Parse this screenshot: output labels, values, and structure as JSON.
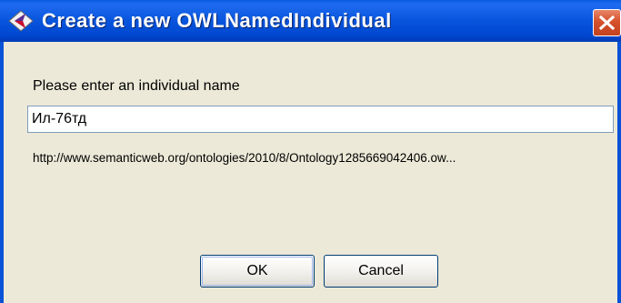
{
  "window": {
    "title": "Create a new OWLNamedIndividual",
    "icons": {
      "app": "protege-diamond-icon",
      "close": "close-icon"
    },
    "colors": {
      "titlebar": "#0855dd",
      "close_button": "#d6512c",
      "background": "#ece9d8"
    }
  },
  "form": {
    "prompt_label": "Please enter an individual name",
    "name_value": "Ил-76тд",
    "iri_preview": "http://www.semanticweb.org/ontologies/2010/8/Ontology1285669042406.ow..."
  },
  "buttons": {
    "ok_label": "OK",
    "cancel_label": "Cancel"
  }
}
